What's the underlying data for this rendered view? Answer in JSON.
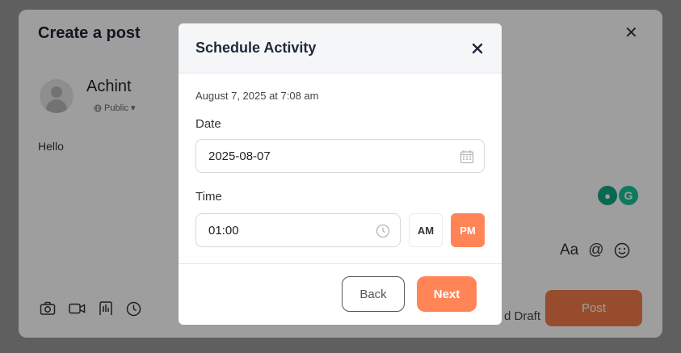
{
  "composer": {
    "title": "Create a post",
    "user_name": "Achint",
    "visibility": "Public",
    "post_text": "Hello",
    "format_label": "Aa",
    "mention_symbol": "@",
    "draft_label": "d Draft",
    "post_label": "Post",
    "accent_color": "#f47c4a"
  },
  "modal": {
    "title": "Schedule Activity",
    "scheduled_text": "August 7, 2025 at 7:08 am",
    "date_label": "Date",
    "date_value": "2025-08-07",
    "time_label": "Time",
    "time_value": "01:00",
    "am_label": "AM",
    "pm_label": "PM",
    "selected_period": "PM",
    "back_label": "Back",
    "next_label": "Next",
    "accent_color": "#ff8557"
  },
  "icons": [
    "close-icon",
    "calendar-icon",
    "clock-icon",
    "globe-icon",
    "camera-icon",
    "video-icon",
    "poll-icon",
    "schedule-clock-icon",
    "emoji-icon",
    "mention-icon",
    "grammarly-icon"
  ]
}
